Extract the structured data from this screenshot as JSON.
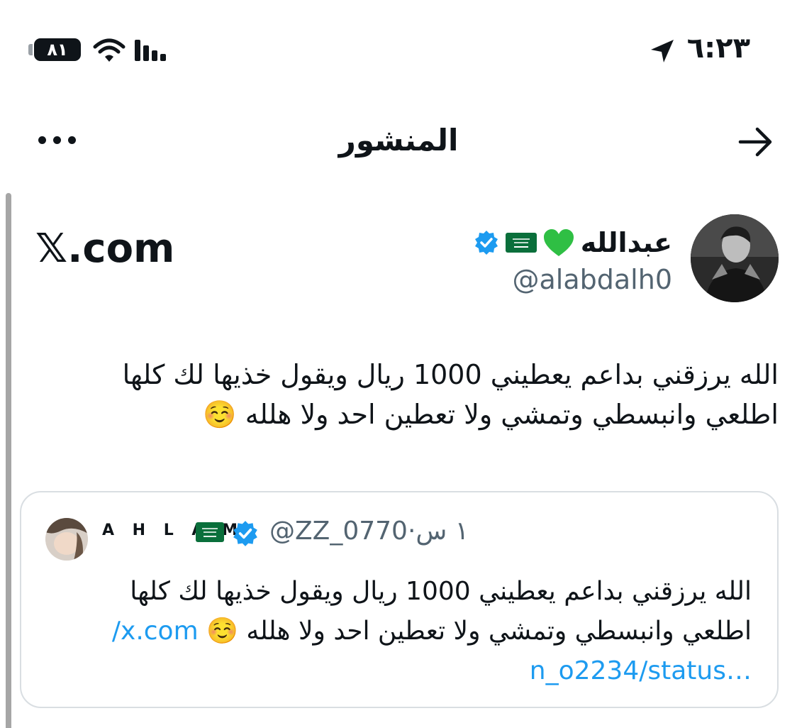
{
  "status_bar": {
    "time": "٦:٢٣",
    "battery": "٨١"
  },
  "header": {
    "title": "المنشور"
  },
  "tweet": {
    "author": {
      "display_name": "عبدالله",
      "handle": "@alabdalh0"
    },
    "source": "𝕏.com",
    "text_lines": [
      "الله يرزقني بداعم يعطيني 1000 ريال ويقول خذيها لك كلها",
      "اطلعي وانبسطي وتمشي ولا تعطين احد ولا هلله"
    ],
    "text_emoji": "☺️"
  },
  "quoted_tweet": {
    "author": {
      "display_name": "A H L A M",
      "handle": "@ZZ_0770"
    },
    "separator": "·",
    "time_ago": "١ س",
    "text_lines": [
      "الله يرزقني بداعم يعطيني 1000 ريال ويقول خذيها لك كلها",
      "اطلعي وانبسطي وتمشي ولا تعطين احد ولا هلله"
    ],
    "text_emoji": "☺️",
    "link_line_1": "x.com/",
    "link_line_2": "…n_o2234/status"
  },
  "colors": {
    "text": "#0f1419",
    "secondary": "#536471",
    "link": "#1d9bf0",
    "verified": "#1d9bf0",
    "heart": "#2fbf44",
    "flag": "#0a6f3b",
    "border": "#d9dee2"
  },
  "icons": {
    "battery": "battery-icon",
    "wifi": "wifi-icon",
    "signal": "cellular-signal-icon",
    "location": "location-arrow-icon",
    "more": "more-horizontal-icon",
    "back": "arrow-right-icon",
    "verified": "verified-badge-icon",
    "heart": "green-heart-icon",
    "flag": "saudi-flag-icon",
    "smile": "smiling-face-icon"
  }
}
